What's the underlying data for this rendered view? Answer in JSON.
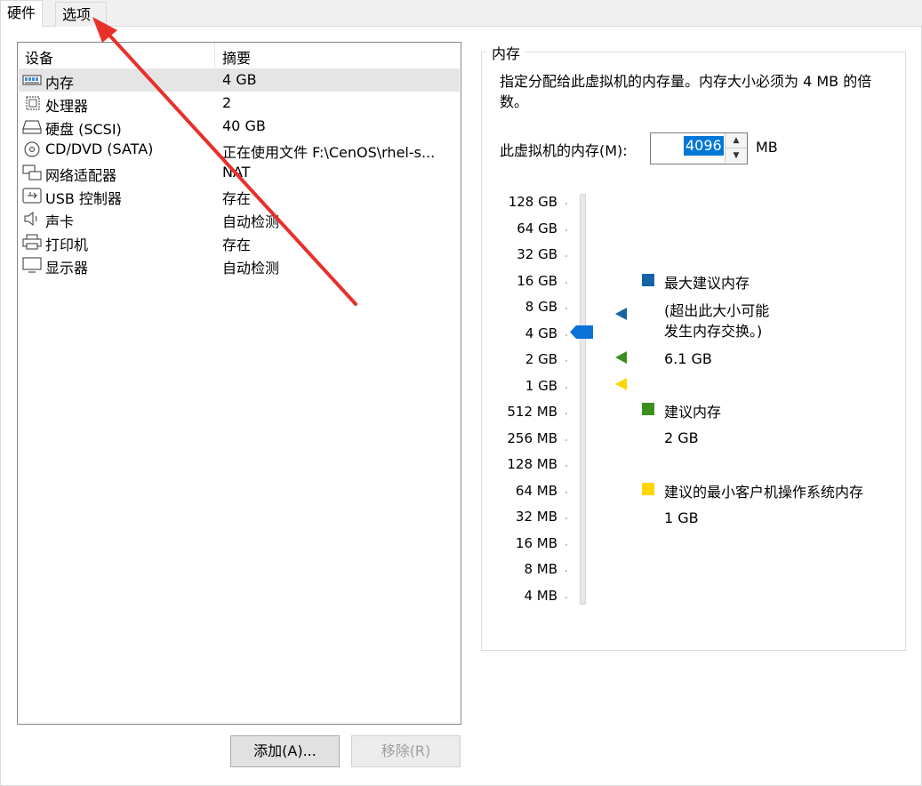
{
  "tabs": [
    {
      "label": "硬件"
    },
    {
      "label": "选项"
    }
  ],
  "device_list": {
    "headers": {
      "device": "设备",
      "summary": "摘要"
    },
    "rows": [
      {
        "icon": "memory-icon",
        "name": "内存",
        "summary": "4 GB"
      },
      {
        "icon": "cpu-icon",
        "name": "处理器",
        "summary": "2"
      },
      {
        "icon": "hard-disk-icon",
        "name": "硬盘 (SCSI)",
        "summary": "40 GB"
      },
      {
        "icon": "cd-dvd-icon",
        "name": "CD/DVD (SATA)",
        "summary": "正在使用文件 F:\\CenOS\\rhel-s..."
      },
      {
        "icon": "network-adapter-icon",
        "name": "网络适配器",
        "summary": "NAT"
      },
      {
        "icon": "usb-icon",
        "name": "USB 控制器",
        "summary": "存在"
      },
      {
        "icon": "sound-icon",
        "name": "声卡",
        "summary": "自动检测"
      },
      {
        "icon": "printer-icon",
        "name": "打印机",
        "summary": "存在"
      },
      {
        "icon": "display-icon",
        "name": "显示器",
        "summary": "自动检测"
      }
    ]
  },
  "buttons": {
    "add": "添加(A)...",
    "remove": "移除(R)"
  },
  "memory": {
    "group_title": "内存",
    "description": "指定分配给此虚拟机的内存量。内存大小必须为 4 MB 的倍数。",
    "field_label": "此虚拟机的内存(M):",
    "value": "4096",
    "unit": "MB",
    "scale": [
      "128 GB",
      "64 GB",
      "32 GB",
      "16 GB",
      "8 GB",
      "4 GB",
      "2 GB",
      "1 GB",
      "512 MB",
      "256 MB",
      "128 MB",
      "64 MB",
      "32 MB",
      "16 MB",
      "8 MB",
      "4 MB"
    ],
    "legend": {
      "max": {
        "title": "最大建议内存",
        "note": "(超出此大小可能\n发生内存交换。)",
        "value": "6.1 GB",
        "color": "#1464a5"
      },
      "recommended": {
        "title": "建议内存",
        "value": "2 GB",
        "color": "#3c8f1e"
      },
      "min": {
        "title": "建议的最小客户机操作系统内存",
        "value": "1 GB",
        "color": "#ffd600"
      }
    }
  },
  "colors": {
    "annotation_arrow": "#e8302b",
    "slider_thumb": "#0a72d6"
  }
}
